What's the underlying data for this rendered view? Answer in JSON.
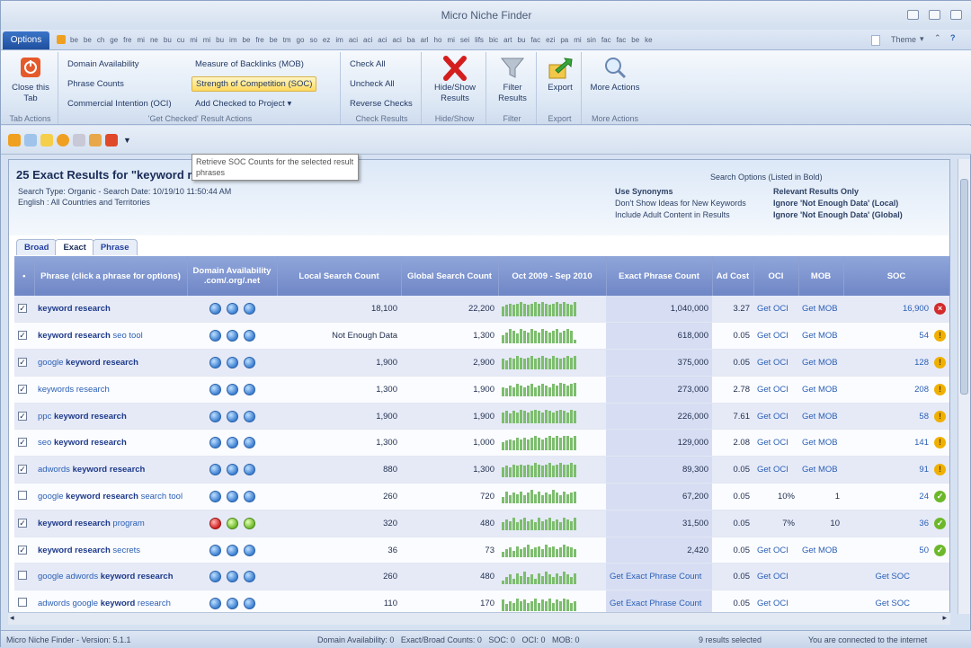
{
  "window": {
    "title": "Micro Niche Finder"
  },
  "menu": {
    "options_label": "Options",
    "tabs": [
      "be",
      "be",
      "ch",
      "ge",
      "fre",
      "mi",
      "ne",
      "bu",
      "cu",
      "mi",
      "mi",
      "bu",
      "im",
      "be",
      "fre",
      "be",
      "tm",
      "go",
      "so",
      "ez",
      "im",
      "aci",
      "aci",
      "aci",
      "aci",
      "ba",
      "arl",
      "ho",
      "mi",
      "sei",
      "lifs",
      "bic",
      "art",
      "bu",
      "fac",
      "ezi",
      "pa",
      "mi",
      "sin",
      "fac",
      "fac",
      "be",
      "ke"
    ],
    "theme_label": "Theme"
  },
  "ribbon": {
    "tab_actions": {
      "close_label": "Close this Tab",
      "group": "Tab Actions"
    },
    "get_checked": {
      "items": [
        "Domain Availability",
        "Phrase Counts",
        "Commercial Intention (OCI)",
        "Measure of Backlinks (MOB)",
        "Strength of Competition (SOC)",
        "Add Checked to Project"
      ],
      "group": "'Get Checked' Result Actions"
    },
    "check_results": {
      "items": [
        "Check All",
        "Uncheck All",
        "Reverse Checks"
      ],
      "group": "Check Results"
    },
    "hide_show": {
      "label": "Hide/Show Results",
      "group": "Hide/Show"
    },
    "filter": {
      "label": "Filter Results",
      "group": "Filter"
    },
    "export": {
      "label": "Export",
      "group": "Export"
    },
    "more": {
      "label": "More Actions",
      "group": "More Actions"
    }
  },
  "tooltip": {
    "text": "Retrieve SOC Counts for the selected result phrases"
  },
  "results": {
    "title": "25 Exact Results for \"keyword r",
    "search_type": "Search Type: Organic - Search Date: 10/19/10 11:50:44 AM",
    "region": "English : All Countries and Territories",
    "search_options_title": "Search Options (Listed in Bold)",
    "options_left": [
      "Use Synonyms",
      "Don't Show Ideas for New Keywords",
      "Include Adult Content in Results"
    ],
    "options_right": [
      "Relevant Results Only",
      "Ignore 'Not Enough Data' (Local)",
      "Ignore 'Not Enough Data' (Global)"
    ],
    "subtabs": [
      "Broad",
      "Exact",
      "Phrase"
    ]
  },
  "grid": {
    "headers": {
      "phrase": "Phrase (click a phrase for options)",
      "domain": "Domain Availability .com/.org/.net",
      "local": "Local Search Count",
      "global": "Global Search Count",
      "trend": "Oct 2009 - Sep 2010",
      "exact": "Exact Phrase Count",
      "adcost": "Ad Cost",
      "oci": "OCI",
      "mob": "MOB",
      "soc": "SOC"
    },
    "rows": [
      {
        "checked": true,
        "pre": "",
        "bold": "keyword research",
        "post": "",
        "domain": [
          "q",
          "q",
          "q"
        ],
        "local": "18,100",
        "global": "22,200",
        "trend": [
          6,
          7,
          8,
          7,
          8,
          9,
          8,
          7,
          8,
          9,
          8,
          9,
          8,
          7,
          8,
          9,
          8,
          9,
          8,
          7,
          9
        ],
        "exact": "1,040,000",
        "adcost": "3.27",
        "oci": "Get OCI",
        "mob": "Get MOB",
        "soc": "16,900",
        "soc_icon": "red"
      },
      {
        "checked": true,
        "pre": "",
        "bold": "keyword research",
        "post": " seo tool",
        "domain": [
          "q",
          "q",
          "q"
        ],
        "local": "Not Enough Data",
        "global": "1,300",
        "trend": [
          5,
          7,
          9,
          8,
          6,
          9,
          8,
          7,
          9,
          8,
          7,
          9,
          8,
          7,
          8,
          9,
          7,
          8,
          9,
          8,
          2
        ],
        "exact": "618,000",
        "adcost": "0.05",
        "oci": "Get OCI",
        "mob": "Get MOB",
        "soc": "54",
        "soc_icon": "warn"
      },
      {
        "checked": true,
        "pre": "google ",
        "bold": "keyword research",
        "post": "",
        "domain": [
          "q",
          "q",
          "q"
        ],
        "local": "1,900",
        "global": "2,900",
        "trend": [
          7,
          6,
          8,
          7,
          9,
          8,
          7,
          8,
          9,
          7,
          8,
          9,
          8,
          7,
          9,
          8,
          7,
          8,
          9,
          8,
          9
        ],
        "exact": "375,000",
        "adcost": "0.05",
        "oci": "Get OCI",
        "mob": "Get MOB",
        "soc": "128",
        "soc_icon": "warn"
      },
      {
        "checked": true,
        "pre": "keywords research",
        "bold": "",
        "post": "",
        "domain": [
          "q",
          "q",
          "q"
        ],
        "local": "1,300",
        "global": "1,900",
        "trend": [
          6,
          5,
          7,
          6,
          8,
          7,
          6,
          7,
          8,
          6,
          7,
          8,
          7,
          6,
          8,
          7,
          9,
          8,
          7,
          8,
          9
        ],
        "exact": "273,000",
        "adcost": "2.78",
        "oci": "Get OCI",
        "mob": "Get MOB",
        "soc": "208",
        "soc_icon": "warn"
      },
      {
        "checked": true,
        "pre": "ppc ",
        "bold": "keyword research",
        "post": "",
        "domain": [
          "q",
          "q",
          "q"
        ],
        "local": "1,900",
        "global": "1,900",
        "trend": [
          7,
          8,
          6,
          8,
          7,
          9,
          8,
          7,
          8,
          9,
          8,
          7,
          9,
          8,
          7,
          8,
          9,
          8,
          7,
          9,
          8
        ],
        "exact": "226,000",
        "adcost": "7.61",
        "oci": "Get OCI",
        "mob": "Get MOB",
        "soc": "58",
        "soc_icon": "warn"
      },
      {
        "checked": true,
        "pre": "seo ",
        "bold": "keyword research",
        "post": "",
        "domain": [
          "q",
          "q",
          "q"
        ],
        "local": "1,300",
        "global": "1,000",
        "trend": [
          5,
          6,
          7,
          6,
          8,
          7,
          8,
          7,
          8,
          9,
          8,
          7,
          8,
          9,
          8,
          9,
          8,
          9,
          9,
          8,
          9
        ],
        "exact": "129,000",
        "adcost": "2.08",
        "oci": "Get OCI",
        "mob": "Get MOB",
        "soc": "141",
        "soc_icon": "warn"
      },
      {
        "checked": true,
        "pre": "adwords ",
        "bold": "keyword research",
        "post": "",
        "domain": [
          "q",
          "q",
          "q"
        ],
        "local": "880",
        "global": "1,300",
        "trend": [
          6,
          7,
          6,
          8,
          7,
          8,
          7,
          8,
          7,
          9,
          8,
          7,
          8,
          9,
          7,
          8,
          9,
          8,
          8,
          9,
          8
        ],
        "exact": "89,300",
        "adcost": "0.05",
        "oci": "Get OCI",
        "mob": "Get MOB",
        "soc": "91",
        "soc_icon": "warn"
      },
      {
        "checked": false,
        "pre": "google ",
        "bold": "keyword research",
        "post": " search tool",
        "domain": [
          "q",
          "q",
          "q"
        ],
        "local": "260",
        "global": "720",
        "trend": [
          4,
          8,
          5,
          7,
          6,
          8,
          5,
          7,
          9,
          6,
          8,
          5,
          7,
          6,
          9,
          7,
          5,
          8,
          6,
          7,
          8
        ],
        "exact": "67,200",
        "adcost": "0.05",
        "oci": "10%",
        "mob": "1",
        "soc": "24",
        "soc_icon": "ok"
      },
      {
        "checked": true,
        "pre": "",
        "bold": "keyword research",
        "post": " program",
        "domain": [
          "red",
          "green",
          "green"
        ],
        "local": "320",
        "global": "480",
        "trend": [
          5,
          7,
          6,
          8,
          5,
          7,
          8,
          6,
          7,
          5,
          8,
          6,
          7,
          8,
          6,
          7,
          5,
          8,
          7,
          6,
          8
        ],
        "exact": "31,500",
        "adcost": "0.05",
        "oci": "7%",
        "mob": "10",
        "soc": "36",
        "soc_icon": "ok"
      },
      {
        "checked": true,
        "pre": "",
        "bold": "keyword research",
        "post": " secrets",
        "domain": [
          "q",
          "q",
          "q"
        ],
        "local": "36",
        "global": "73",
        "trend": [
          3,
          5,
          6,
          4,
          7,
          5,
          6,
          8,
          5,
          6,
          7,
          5,
          8,
          6,
          7,
          5,
          6,
          8,
          7,
          6,
          5
        ],
        "exact": "2,420",
        "adcost": "0.05",
        "oci": "Get OCI",
        "mob": "Get MOB",
        "soc": "50",
        "soc_icon": "ok"
      },
      {
        "checked": false,
        "pre": "google adwords ",
        "bold": "keyword research",
        "post": "",
        "domain": [
          "q",
          "q",
          "q"
        ],
        "local": "260",
        "global": "480",
        "trend": [
          2,
          4,
          6,
          3,
          7,
          5,
          8,
          4,
          6,
          3,
          7,
          5,
          8,
          6,
          4,
          7,
          5,
          8,
          6,
          4,
          7
        ],
        "exact": "Get Exact Phrase Count",
        "adcost": "0.05",
        "oci": "Get OCI",
        "mob": "",
        "soc": "Get SOC",
        "soc_icon": ""
      },
      {
        "checked": false,
        "pre": "adwords google ",
        "bold": "keyword",
        "post": " research",
        "domain": [
          "q",
          "q",
          "q"
        ],
        "local": "110",
        "global": "170",
        "trend": [
          7,
          4,
          6,
          5,
          8,
          6,
          7,
          5,
          6,
          8,
          5,
          7,
          6,
          8,
          5,
          7,
          6,
          8,
          7,
          5,
          6
        ],
        "exact": "Get Exact Phrase Count",
        "adcost": "0.05",
        "oci": "Get OCI",
        "mob": "",
        "soc": "Get SOC",
        "soc_icon": ""
      }
    ]
  },
  "status": {
    "version": "Micro Niche Finder - Version: 5.1.1",
    "counts": "Domain Availability: 0   Exact/Broad Counts: 0   SOC: 0   OCI: 0   MOB: 0",
    "selected": "9 results selected",
    "connection": "You are connected to the internet"
  }
}
